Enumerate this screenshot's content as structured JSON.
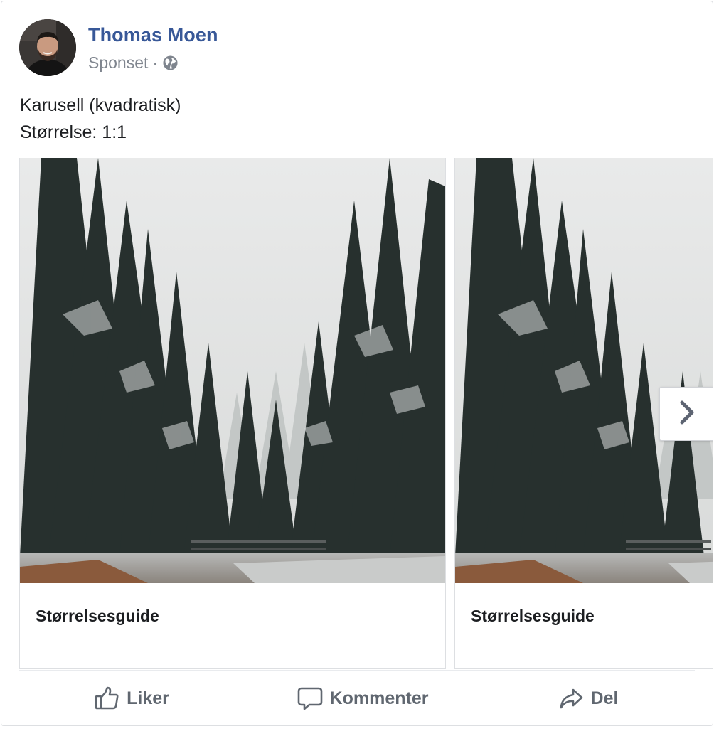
{
  "post": {
    "author": "Thomas Moen",
    "meta": "Sponset",
    "meta_separator": "·",
    "audience_icon": "globe-icon",
    "text_lines": [
      "Karusell (kvadratisk)",
      "Størrelse: 1:1"
    ]
  },
  "carousel": {
    "cards": [
      {
        "headline": "Størrelsesguide",
        "image": "snowy-forest-photo"
      },
      {
        "headline": "Størrelsesguide",
        "image": "snowy-forest-photo"
      }
    ],
    "next_icon": "chevron-right-icon"
  },
  "actions": {
    "like": {
      "label": "Liker",
      "icon": "thumbs-up-icon"
    },
    "comment": {
      "label": "Kommenter",
      "icon": "comment-icon"
    },
    "share": {
      "label": "Del",
      "icon": "share-icon"
    }
  },
  "colors": {
    "author_link": "#385898",
    "secondary_text": "#7f858e",
    "primary_text": "#1c1e21",
    "action_text": "#606770",
    "border": "#dddfe2"
  }
}
